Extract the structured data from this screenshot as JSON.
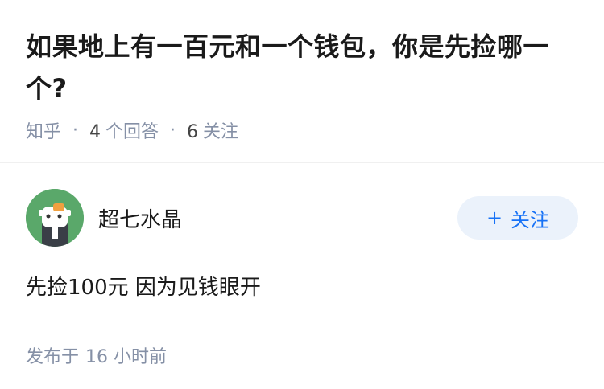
{
  "question": {
    "title": "如果地上有一百元和一个钱包，你是先捡哪一个?",
    "source": "知乎",
    "answers_count": "4",
    "answers_label": "个回答",
    "followers_count": "6",
    "followers_label": "关注"
  },
  "answer": {
    "author_name": "超七水晶",
    "follow_button_label": "关注",
    "content": "先捡100元 因为见钱眼开",
    "published_prefix": "发布于",
    "published_time": "16 小时前"
  },
  "colors": {
    "accent": "#1772f6",
    "follow_bg": "#ebf2fb",
    "meta_gray": "#8590a6",
    "avatar_green": "#5aa86a"
  }
}
